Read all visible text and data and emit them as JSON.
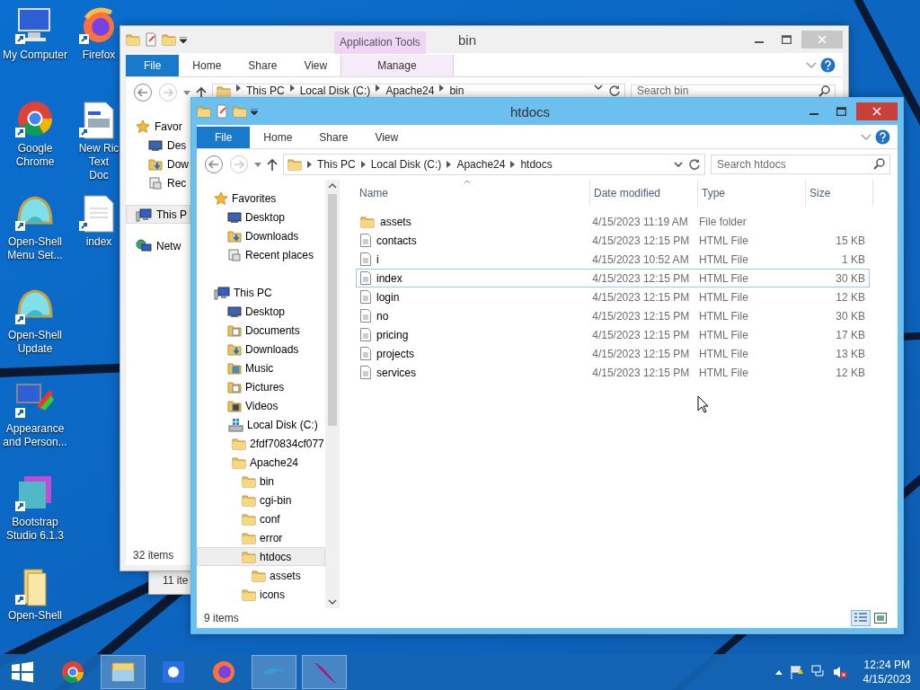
{
  "desktop_icon_columns": [
    [
      {
        "label": "My Computer",
        "kind": "computer"
      },
      {
        "label": "Google Chrome",
        "kind": "chrome"
      },
      {
        "label": "Open-Shell Menu Set...",
        "kind": "shell"
      },
      {
        "label": "Open-Shell Update",
        "kind": "shell"
      },
      {
        "label": "Appearance and Person...",
        "kind": "appearance"
      },
      {
        "label": "Bootstrap Studio 6.1.3",
        "kind": "bootstrap"
      },
      {
        "label": "Open-Shell",
        "kind": "folder"
      }
    ],
    [
      {
        "label": "Firefox",
        "kind": "firefox"
      },
      {
        "label": "New Ric Text Doc",
        "kind": "document"
      },
      {
        "label": "index",
        "kind": "text"
      }
    ]
  ],
  "third_window": {
    "status_bar": "11 ite"
  },
  "back_window": {
    "title": "bin",
    "contextual_group": "Application Tools",
    "ribbon_tabs": [
      {
        "label": "File",
        "kind": "file"
      },
      {
        "label": "Home",
        "kind": "tab"
      },
      {
        "label": "Share",
        "kind": "tab"
      },
      {
        "label": "View",
        "kind": "tab"
      },
      {
        "label": "Manage",
        "kind": "contextual"
      }
    ],
    "breadcrumbs": [
      "This PC",
      "Local Disk (C:)",
      "Apache24",
      "bin"
    ],
    "search": {
      "placeholder": "Search bin"
    },
    "sidebar": [
      {
        "label": "Favor",
        "kind": "favorites",
        "selected": false
      },
      {
        "label": "Des",
        "kind": "desktop",
        "selected": false
      },
      {
        "label": "Dow",
        "kind": "downloads",
        "selected": false
      },
      {
        "label": "Rec",
        "kind": "recent",
        "selected": false
      },
      {
        "label": "This P",
        "kind": "pc",
        "selected": true
      },
      {
        "label": "Netw",
        "kind": "network",
        "selected": false
      }
    ],
    "status_bar": "32 items"
  },
  "window": {
    "title": "htdocs",
    "ribbon_tabs": [
      {
        "label": "File",
        "kind": "file"
      },
      {
        "label": "Home",
        "kind": "tab"
      },
      {
        "label": "Share",
        "kind": "tab"
      },
      {
        "label": "View",
        "kind": "tab"
      }
    ],
    "breadcrumbs": [
      "This PC",
      "Local Disk (C:)",
      "Apache24",
      "htdocs"
    ],
    "search": {
      "placeholder": "Search htdocs"
    },
    "sidebar": [
      {
        "label": "Favorites",
        "kind": "favorites",
        "selected": false,
        "children": [
          {
            "label": "Desktop",
            "kind": "desktop",
            "selected": false
          },
          {
            "label": "Downloads",
            "kind": "downloads",
            "selected": false
          },
          {
            "label": "Recent places",
            "kind": "recent",
            "selected": false
          }
        ]
      },
      {
        "label": "This PC",
        "kind": "pc",
        "selected": false,
        "children": [
          {
            "label": "Desktop",
            "kind": "desktop",
            "selected": false
          },
          {
            "label": "Documents",
            "kind": "documents",
            "selected": false
          },
          {
            "label": "Downloads",
            "kind": "downloads",
            "selected": false
          },
          {
            "label": "Music",
            "kind": "music",
            "selected": false
          },
          {
            "label": "Pictures",
            "kind": "pictures",
            "selected": false
          },
          {
            "label": "Videos",
            "kind": "videos",
            "selected": false
          },
          {
            "label": "Local Disk (C:)",
            "kind": "disk",
            "selected": false,
            "children": [
              {
                "label": "2fdf70834cf077",
                "kind": "folder",
                "selected": false
              },
              {
                "label": "Apache24",
                "kind": "folder",
                "selected": false,
                "children": [
                  {
                    "label": "bin",
                    "kind": "folder",
                    "selected": false
                  },
                  {
                    "label": "cgi-bin",
                    "kind": "folder",
                    "selected": false
                  },
                  {
                    "label": "conf",
                    "kind": "folder",
                    "selected": false
                  },
                  {
                    "label": "error",
                    "kind": "folder",
                    "selected": false
                  },
                  {
                    "label": "htdocs",
                    "kind": "folder",
                    "selected": true,
                    "children": [
                      {
                        "label": "assets",
                        "kind": "folder",
                        "selected": false
                      }
                    ]
                  },
                  {
                    "label": "icons",
                    "kind": "folder",
                    "selected": false
                  }
                ]
              }
            ]
          }
        ]
      }
    ],
    "columns": [
      "Name",
      "Date modified",
      "Type",
      "Size"
    ],
    "files": [
      {
        "name": "assets",
        "date": "4/15/2023 11:19 AM",
        "type": "File folder",
        "kind": "folder",
        "selected": false
      },
      {
        "name": "contacts",
        "date": "4/15/2023 12:15 PM",
        "type": "HTML File",
        "size": "15 KB",
        "kind": "file",
        "selected": false
      },
      {
        "name": "i",
        "date": "4/15/2023 10:52 AM",
        "type": "HTML File",
        "size": "1 KB",
        "kind": "file",
        "selected": false
      },
      {
        "name": "index",
        "date": "4/15/2023 12:15 PM",
        "type": "HTML File",
        "size": "30 KB",
        "kind": "file",
        "selected": true
      },
      {
        "name": "login",
        "date": "4/15/2023 12:15 PM",
        "type": "HTML File",
        "size": "12 KB",
        "kind": "file",
        "selected": false
      },
      {
        "name": "no",
        "date": "4/15/2023 12:15 PM",
        "type": "HTML File",
        "size": "30 KB",
        "kind": "file",
        "selected": false
      },
      {
        "name": "pricing",
        "date": "4/15/2023 12:15 PM",
        "type": "HTML File",
        "size": "17 KB",
        "kind": "file",
        "selected": false
      },
      {
        "name": "projects",
        "date": "4/15/2023 12:15 PM",
        "type": "HTML File",
        "size": "13 KB",
        "kind": "file",
        "selected": false
      },
      {
        "name": "services",
        "date": "4/15/2023 12:15 PM",
        "type": "HTML File",
        "size": "12 KB",
        "kind": "file",
        "selected": false
      }
    ],
    "status_bar": "9 items"
  },
  "taskbar": {
    "apps": [
      {
        "kind": "start",
        "active": false
      },
      {
        "kind": "chrome",
        "active": false
      },
      {
        "kind": "explorer",
        "active": true
      },
      {
        "kind": "sun",
        "active": false
      },
      {
        "kind": "firefox",
        "active": false
      },
      {
        "kind": "dolphin",
        "active": true
      },
      {
        "kind": "feather",
        "active": true
      }
    ],
    "time": "12:24 PM",
    "date": "4/15/2023"
  }
}
